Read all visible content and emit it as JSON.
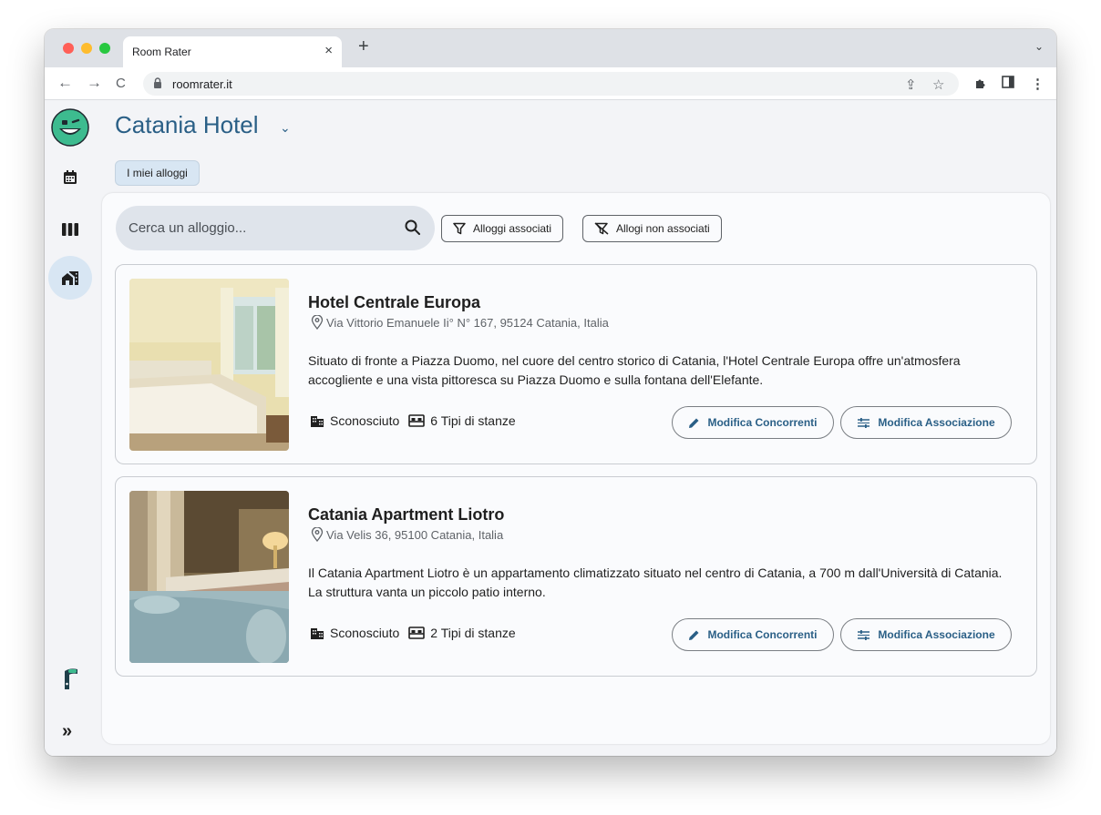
{
  "browser": {
    "tab_title": "Room Rater",
    "tab_close": "×",
    "new_tab": "+",
    "tabs_menu": "⌄",
    "url": "roomrater.it"
  },
  "app": {
    "hotel_name": "Catania Hotel",
    "hotel_chevron": "⌄",
    "section_tab": "I miei alloggi",
    "search": {
      "placeholder": "Cerca un alloggio..."
    },
    "filters": {
      "associated": "Alloggi associati",
      "not_associated": "Allogi non associati"
    },
    "properties": [
      {
        "name": "Hotel Centrale Europa",
        "address": "Via Vittorio Emanuele Ii° N° 167, 95124 Catania, Italia",
        "description": "Situato di fronte a Piazza Duomo, nel cuore del centro storico di Catania, l'Hotel Centrale Europa offre un'atmosfera accogliente e una vista pittoresca su Piazza Duomo e sulla fontana dell'Elefante.",
        "category": "Sconosciuto",
        "room_types": "6 Tipi di stanze",
        "edit_competitors": "Modifica Concorrenti",
        "edit_association": "Modifica Associazione"
      },
      {
        "name": "Catania Apartment Liotro",
        "address": "Via Velis 36, 95100 Catania, Italia",
        "description": "Il Catania Apartment Liotro è un appartamento climatizzato situato nel centro di Catania, a 700 m dall'Università di Catania. La struttura vanta un piccolo patio interno.",
        "category": "Sconosciuto",
        "room_types": "2 Tipi di stanze",
        "edit_competitors": "Modifica Concorrenti",
        "edit_association": "Modifica Associazione"
      }
    ],
    "sidebar_expand": "»"
  },
  "colors": {
    "accent": "#2a5f86",
    "active_bg": "#d8e6f3",
    "logo": "#3dbb8f"
  }
}
